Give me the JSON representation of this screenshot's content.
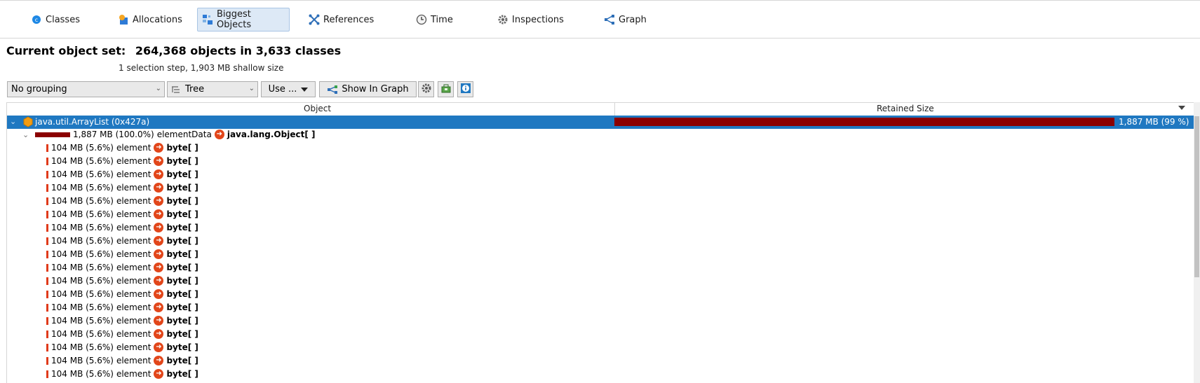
{
  "tabs": [
    {
      "id": "classes",
      "label": "Classes",
      "icon": "classes-icon",
      "active": false
    },
    {
      "id": "allocations",
      "label": "Allocations",
      "icon": "allocations-icon",
      "active": false
    },
    {
      "id": "biggest",
      "label": "Biggest Objects",
      "icon": "biggest-objects-icon",
      "active": true
    },
    {
      "id": "references",
      "label": "References",
      "icon": "references-icon",
      "active": false
    },
    {
      "id": "time",
      "label": "Time",
      "icon": "clock-icon",
      "active": false
    },
    {
      "id": "inspections",
      "label": "Inspections",
      "icon": "gear-icon",
      "active": false
    },
    {
      "id": "graph",
      "label": "Graph",
      "icon": "graph-icon",
      "active": false
    }
  ],
  "header": {
    "label": "Current object set:",
    "summary": "264,368 objects in 3,633 classes",
    "subline": "1 selection step, 1,903 MB shallow size"
  },
  "toolbar": {
    "grouping": "No grouping",
    "view": "Tree",
    "use_label": "Use ...",
    "show_in_graph": "Show In Graph"
  },
  "table": {
    "col_object": "Object",
    "col_retained": "Retained Size",
    "root": {
      "label": "java.util.ArrayList (0x427a)",
      "retained": "1,887 MB (99 %)",
      "retained_fraction": 0.99
    },
    "child": {
      "size": "1,887 MB (100.0%)",
      "field": "elementData",
      "type": "java.lang.Object[ ]"
    },
    "elements": [
      {
        "size": "104 MB (5.6%)",
        "field": "element",
        "type": "byte[ ]"
      },
      {
        "size": "104 MB (5.6%)",
        "field": "element",
        "type": "byte[ ]"
      },
      {
        "size": "104 MB (5.6%)",
        "field": "element",
        "type": "byte[ ]"
      },
      {
        "size": "104 MB (5.6%)",
        "field": "element",
        "type": "byte[ ]"
      },
      {
        "size": "104 MB (5.6%)",
        "field": "element",
        "type": "byte[ ]"
      },
      {
        "size": "104 MB (5.6%)",
        "field": "element",
        "type": "byte[ ]"
      },
      {
        "size": "104 MB (5.6%)",
        "field": "element",
        "type": "byte[ ]"
      },
      {
        "size": "104 MB (5.6%)",
        "field": "element",
        "type": "byte[ ]"
      },
      {
        "size": "104 MB (5.6%)",
        "field": "element",
        "type": "byte[ ]"
      },
      {
        "size": "104 MB (5.6%)",
        "field": "element",
        "type": "byte[ ]"
      },
      {
        "size": "104 MB (5.6%)",
        "field": "element",
        "type": "byte[ ]"
      },
      {
        "size": "104 MB (5.6%)",
        "field": "element",
        "type": "byte[ ]"
      },
      {
        "size": "104 MB (5.6%)",
        "field": "element",
        "type": "byte[ ]"
      },
      {
        "size": "104 MB (5.6%)",
        "field": "element",
        "type": "byte[ ]"
      },
      {
        "size": "104 MB (5.6%)",
        "field": "element",
        "type": "byte[ ]"
      },
      {
        "size": "104 MB (5.6%)",
        "field": "element",
        "type": "byte[ ]"
      },
      {
        "size": "104 MB (5.6%)",
        "field": "element",
        "type": "byte[ ]"
      },
      {
        "size": "104 MB (5.6%)",
        "field": "element",
        "type": "byte[ ]"
      }
    ]
  },
  "colors": {
    "selection": "#1f78c1",
    "retained_bar": "#8b0000",
    "element_bar": "#e03a1a",
    "ref_arrow": "#e2461a"
  }
}
